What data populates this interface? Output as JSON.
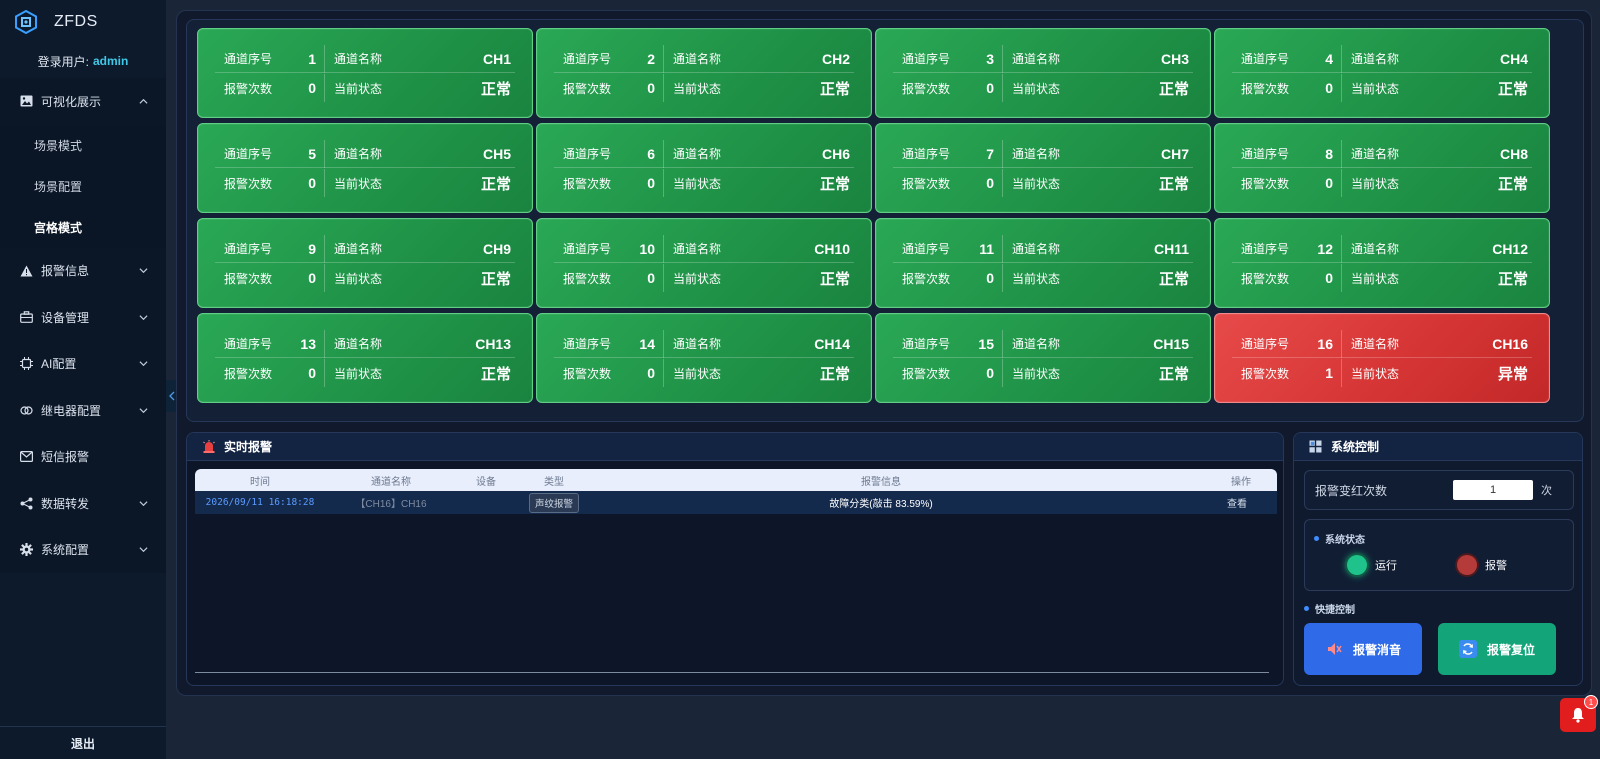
{
  "app": {
    "title": "ZFDS"
  },
  "user": {
    "label": "登录用户:",
    "name": "admin"
  },
  "sidebar": {
    "menu": [
      {
        "label": "可视化展示",
        "icon": "image-icon",
        "expanded": true,
        "children": [
          {
            "label": "场景模式"
          },
          {
            "label": "场景配置"
          },
          {
            "label": "宫格模式",
            "active": true
          }
        ]
      },
      {
        "label": "报警信息",
        "icon": "warning-icon"
      },
      {
        "label": "设备管理",
        "icon": "briefcase-icon"
      },
      {
        "label": "AI配置",
        "icon": "chip-icon"
      },
      {
        "label": "继电器配置",
        "icon": "link-icon"
      },
      {
        "label": "短信报警",
        "icon": "mail-icon"
      },
      {
        "label": "数据转发",
        "icon": "share-icon"
      },
      {
        "label": "系统配置",
        "icon": "gear-icon"
      }
    ],
    "logout": "退出"
  },
  "card_labels": {
    "index": "通道序号",
    "name": "通道名称",
    "alarms": "报警次数",
    "status": "当前状态"
  },
  "channels": [
    {
      "index": "1",
      "name": "CH1",
      "alarms": "0",
      "status": "正常"
    },
    {
      "index": "2",
      "name": "CH2",
      "alarms": "0",
      "status": "正常"
    },
    {
      "index": "3",
      "name": "CH3",
      "alarms": "0",
      "status": "正常"
    },
    {
      "index": "4",
      "name": "CH4",
      "alarms": "0",
      "status": "正常"
    },
    {
      "index": "5",
      "name": "CH5",
      "alarms": "0",
      "status": "正常"
    },
    {
      "index": "6",
      "name": "CH6",
      "alarms": "0",
      "status": "正常"
    },
    {
      "index": "7",
      "name": "CH7",
      "alarms": "0",
      "status": "正常"
    },
    {
      "index": "8",
      "name": "CH8",
      "alarms": "0",
      "status": "正常"
    },
    {
      "index": "9",
      "name": "CH9",
      "alarms": "0",
      "status": "正常"
    },
    {
      "index": "10",
      "name": "CH10",
      "alarms": "0",
      "status": "正常"
    },
    {
      "index": "11",
      "name": "CH11",
      "alarms": "0",
      "status": "正常"
    },
    {
      "index": "12",
      "name": "CH12",
      "alarms": "0",
      "status": "正常"
    },
    {
      "index": "13",
      "name": "CH13",
      "alarms": "0",
      "status": "正常"
    },
    {
      "index": "14",
      "name": "CH14",
      "alarms": "0",
      "status": "正常"
    },
    {
      "index": "15",
      "name": "CH15",
      "alarms": "0",
      "status": "正常"
    },
    {
      "index": "16",
      "name": "CH16",
      "alarms": "1",
      "status": "异常"
    }
  ],
  "colors": {
    "normal": "#22a04e",
    "alarm": "#dc3b3b",
    "run_led": "#1fc28a",
    "alarm_led": "#b53a3a",
    "mute_btn": "#2f6be8",
    "reset_btn": "#14a47a"
  },
  "alarm_panel": {
    "title": "实时报警",
    "columns": {
      "time": "时间",
      "channel": "通道名称",
      "device": "设备",
      "type": "类型",
      "info": "报警信息",
      "op": "操作"
    },
    "rows": [
      {
        "time": "2026/09/11 16:18:28",
        "channel": "【CH16】CH16",
        "device": "",
        "type": "声纹报警",
        "info": "故障分类(敲击 83.59%)",
        "op": "查看"
      }
    ]
  },
  "system_panel": {
    "title": "系统控制",
    "threshold_label": "报警变红次数",
    "threshold_value": "1",
    "threshold_unit": "次",
    "status_title": "系统状态",
    "run_label": "运行",
    "alarm_label": "报警",
    "quick_title": "快捷控制",
    "mute_label": "报警消音",
    "reset_label": "报警复位"
  },
  "notifications": {
    "count": "1"
  }
}
